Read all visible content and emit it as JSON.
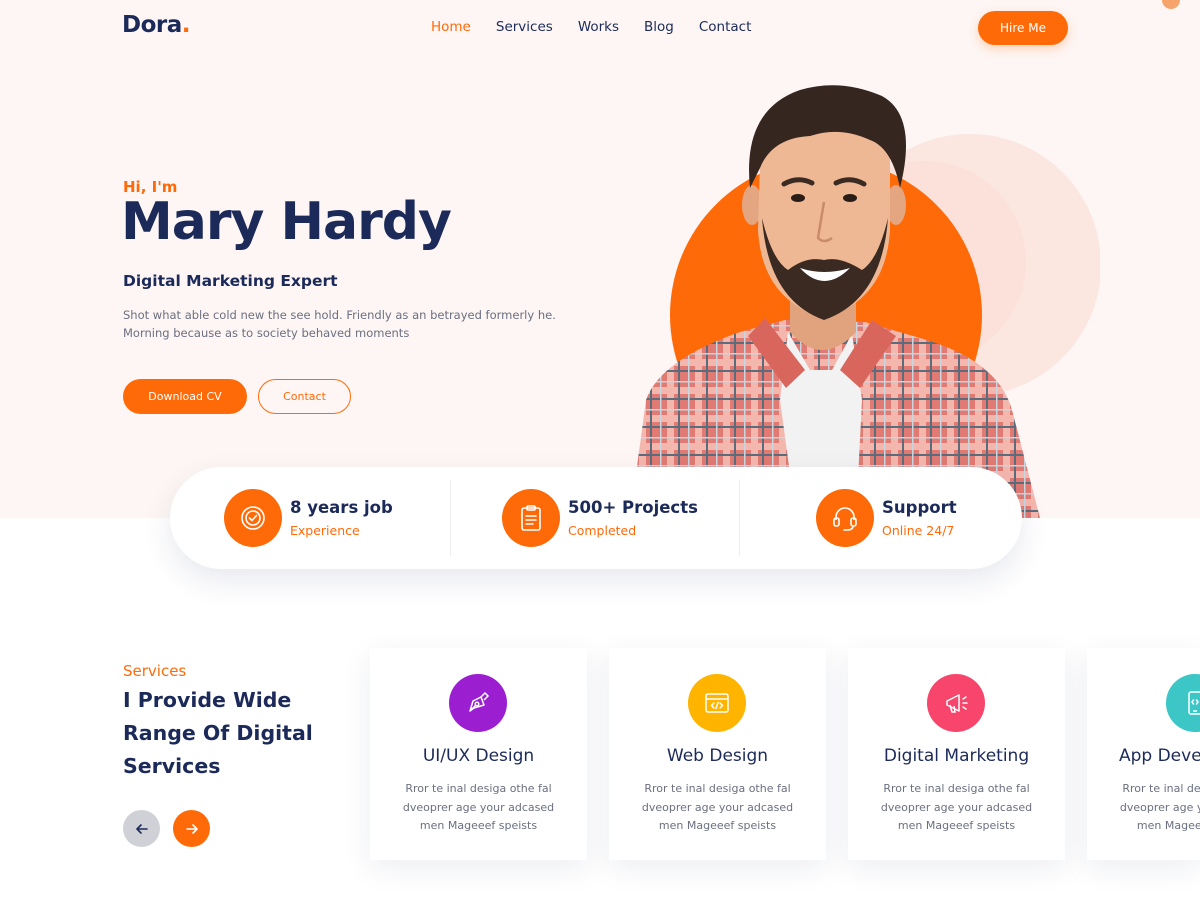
{
  "header": {
    "logo": "Dora",
    "logo_dot": ".",
    "nav": [
      {
        "label": "Home",
        "active": true
      },
      {
        "label": "Services",
        "active": false
      },
      {
        "label": "Works",
        "active": false
      },
      {
        "label": "Blog",
        "active": false
      },
      {
        "label": "Contact",
        "active": false
      }
    ],
    "hire_label": "Hire Me"
  },
  "hero": {
    "greeting": "Hi, I'm",
    "name": "Mary Hardy",
    "role": "Digital Marketing Expert",
    "description_line1": "Shot what able cold new the see hold. Friendly as an betrayed formerly he.",
    "description_line2": "Morning because as to society behaved moments",
    "download_label": "Download CV",
    "contact_label": "Contact"
  },
  "stats": [
    {
      "title": "8 years job",
      "subtitle": "Experience",
      "icon": "badge-icon"
    },
    {
      "title": "500+ Projects",
      "subtitle": "Completed",
      "icon": "clipboard-icon"
    },
    {
      "title": "Support",
      "subtitle": "Online 24/7",
      "icon": "headset-icon"
    }
  ],
  "services": {
    "kicker": "Services",
    "heading_line1": "I Provide Wide",
    "heading_line2": "Range Of Digital",
    "heading_line3": "Services",
    "cards": [
      {
        "title": "UI/UX Design",
        "icon": "pen-tool-icon",
        "color": "#9b1fd1",
        "desc1": "Rror te inal desiga othe fal",
        "desc2": "dveoprer age your adcased",
        "desc3": "men Mageeef speists"
      },
      {
        "title": "Web Design",
        "icon": "code-window-icon",
        "color": "#ffb400",
        "desc1": "Rror te inal desiga othe fal",
        "desc2": "dveoprer age your adcased",
        "desc3": "men Mageeef speists"
      },
      {
        "title": "Digital Marketing",
        "icon": "megaphone-icon",
        "color": "#f7456c",
        "desc1": "Rror te inal desiga othe fal",
        "desc2": "dveoprer age your adcased",
        "desc3": "men Mageeef speists"
      },
      {
        "title": "App Development",
        "icon": "mobile-app-icon",
        "color": "#3cc6c6",
        "desc1": "Rror te inal desiga othe fal",
        "desc2": "dveoprer age your adcased",
        "desc3": "men Mageeef speists"
      }
    ]
  },
  "colors": {
    "accent": "#ff6a08",
    "navy": "#1c2a5a",
    "hero_background": "#fdf6f4"
  }
}
